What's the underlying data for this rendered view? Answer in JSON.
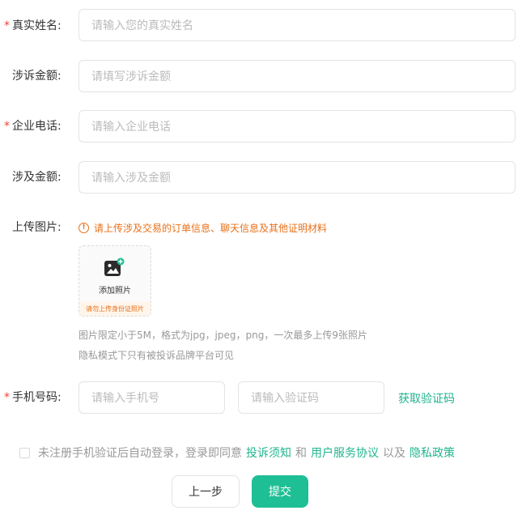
{
  "form": {
    "name": {
      "label": "真实姓名:",
      "required": true,
      "placeholder": "请输入您的真实姓名"
    },
    "amount": {
      "label": "涉诉金额:",
      "required": false,
      "placeholder": "请填写涉诉金额"
    },
    "phone": {
      "label": "企业电话:",
      "required": true,
      "placeholder": "请输入企业电话"
    },
    "involved": {
      "label": "涉及金额:",
      "required": false,
      "placeholder": "请输入涉及金额"
    },
    "upload": {
      "label": "上传图片:",
      "warning": "请上传涉及交易的订单信息、聊天信息及其他证明材料",
      "button_label": "添加照片",
      "button_tip": "请勿上传身份证照片",
      "hint1": "图片限定小于5M，格式为jpg，jpeg，png，一次最多上传9张照片",
      "hint2": "隐私模式下只有被投诉品牌平台可见"
    },
    "mobile": {
      "label": "手机号码:",
      "required": true,
      "phone_placeholder": "请输入手机号",
      "code_placeholder": "请输入验证码",
      "get_code": "获取验证码"
    },
    "agreement": {
      "prefix": "未注册手机验证后自动登录，登录即同意",
      "link1": "投诉须知",
      "and": "和",
      "link2": "用户服务协议",
      "and2": "以及",
      "link3": "隐私政策",
      "checked": false
    },
    "buttons": {
      "prev": "上一步",
      "submit": "提交"
    }
  },
  "colors": {
    "accent": "#1fbf95",
    "warning": "#e8701a",
    "required": "#f04134"
  },
  "icons": {
    "upload": "add-photo-icon",
    "warning": "info-circle-icon"
  },
  "req_mark": "*"
}
